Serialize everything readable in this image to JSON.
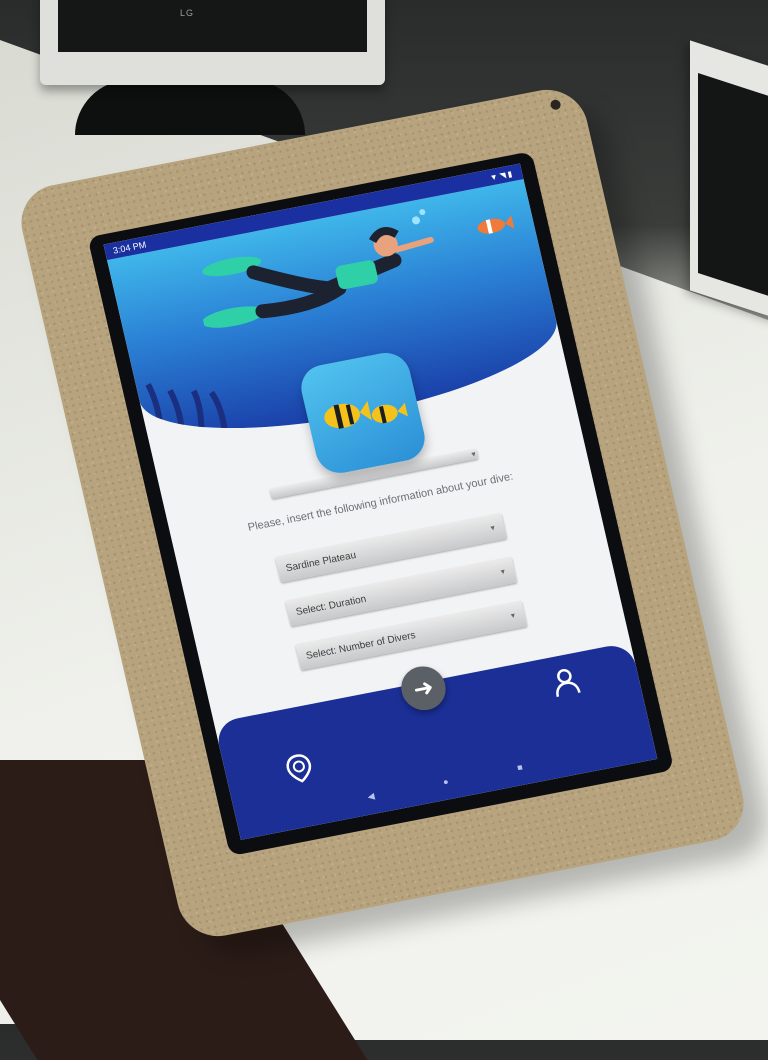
{
  "status_bar": {
    "time": "3:04 PM",
    "icons": "▼◥▮"
  },
  "monitor": {
    "brand": "LG"
  },
  "form": {
    "prompt": "Please, insert the following information about your dive:",
    "first_select": "",
    "site_select": "Sardine Plateau",
    "duration_select": "Select: Duration",
    "divers_select": "Select: Number of Divers"
  },
  "nav": {
    "next_icon": "arrow-right-icon",
    "location_icon": "location-clock-icon",
    "profile_icon": "user-icon"
  },
  "system_nav": {
    "back": "◀",
    "home": "●",
    "recents": "■"
  },
  "colors": {
    "primary": "#1b2f96",
    "hero_top": "#3fb6ea",
    "frame": "#b7a37d"
  }
}
